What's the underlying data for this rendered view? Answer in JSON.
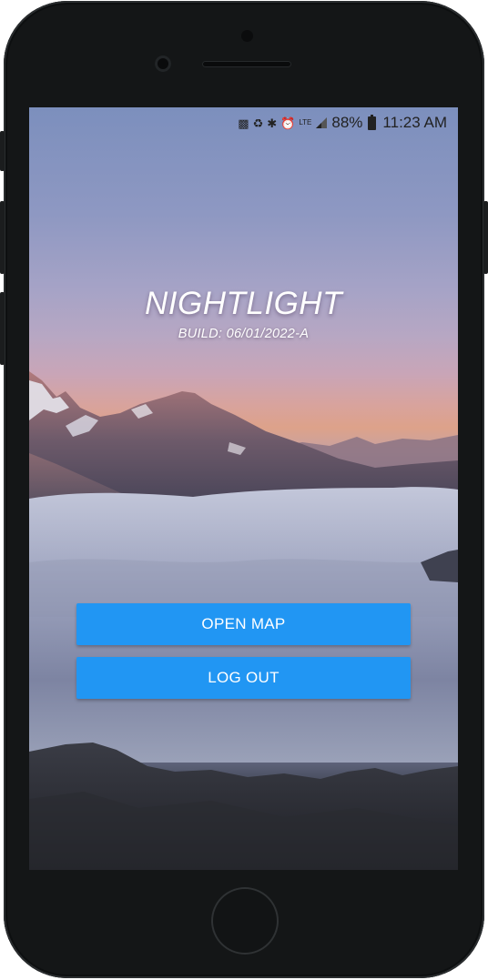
{
  "status_bar": {
    "icons": [
      "sim-icon",
      "recycle-icon",
      "bluetooth-icon",
      "alarm-icon",
      "lte-icon",
      "signal-icon"
    ],
    "lte_label": "LTE",
    "battery_percent": "88%",
    "time": "11:23 AM"
  },
  "app": {
    "title": "NIGHTLIGHT",
    "build_label": "BUILD:  06/01/2022-A"
  },
  "buttons": {
    "open_map": "OPEN MAP",
    "log_out": "LOG OUT"
  },
  "colors": {
    "button_accent": "#2196f3",
    "device_frame": "#141617"
  }
}
